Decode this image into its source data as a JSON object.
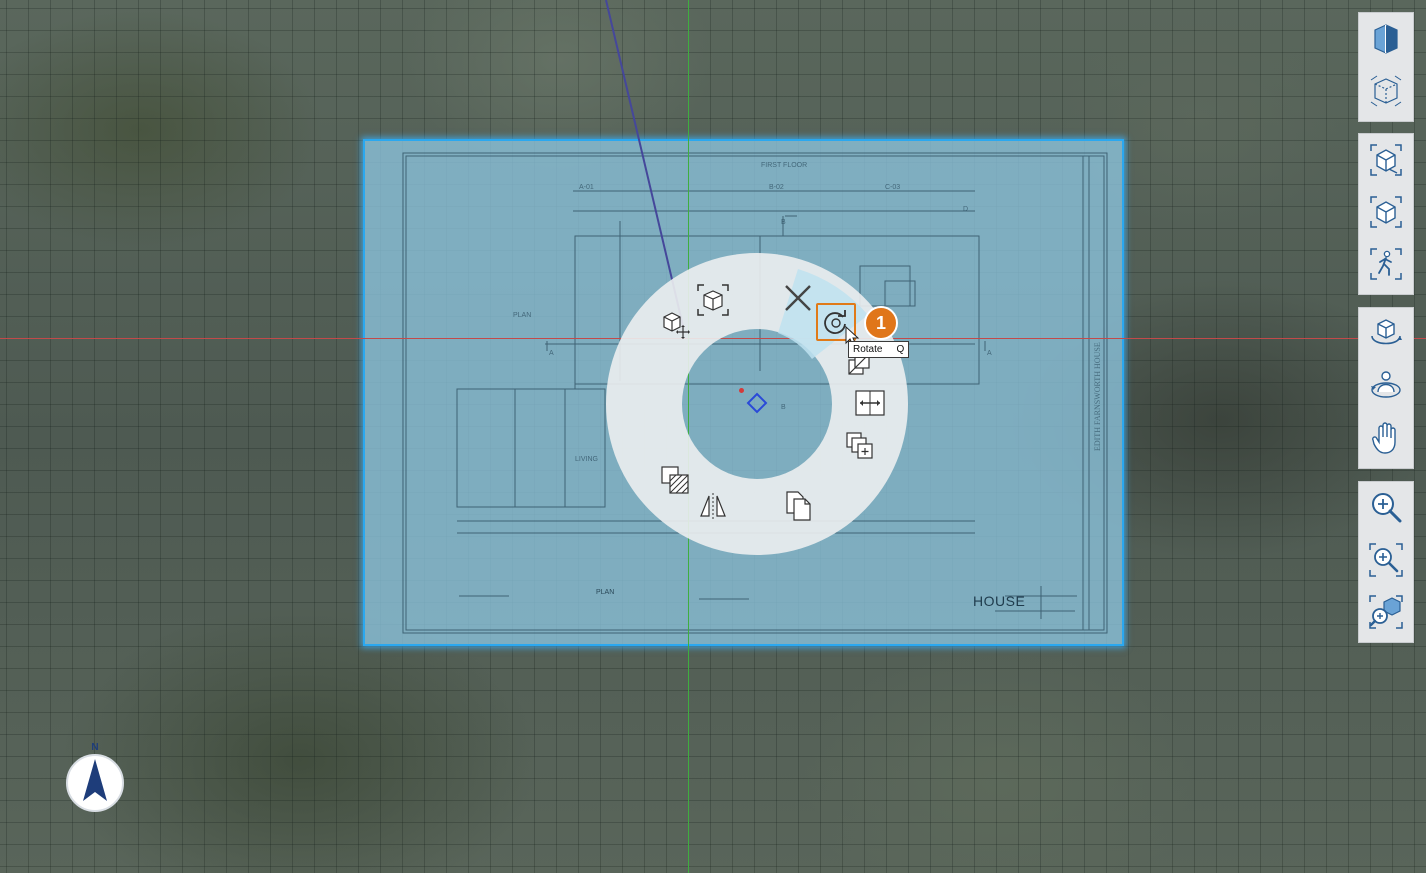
{
  "canvas": {
    "sheet": {
      "house_label": "HOUSE",
      "plan_label": "PLAN",
      "north_label": "N"
    },
    "radial_menu": {
      "items": [
        {
          "name": "move-icon",
          "label": "Move"
        },
        {
          "name": "frame-object-icon",
          "label": "Frame"
        },
        {
          "name": "delete-icon",
          "label": "Delete"
        },
        {
          "name": "rotate-icon",
          "label": "Rotate"
        },
        {
          "name": "scale-icon",
          "label": "Scale"
        },
        {
          "name": "stretch-icon",
          "label": "Stretch"
        },
        {
          "name": "duplicate-icon",
          "label": "Duplicate"
        },
        {
          "name": "copy-icon",
          "label": "Copy"
        },
        {
          "name": "mirror-icon",
          "label": "Mirror"
        },
        {
          "name": "material-icon",
          "label": "Material"
        }
      ],
      "active_item": "Rotate"
    },
    "tooltip": {
      "label": "Rotate",
      "shortcut": "Q"
    },
    "callout": "1",
    "compass_label": "N"
  },
  "toolbar": {
    "groups": [
      {
        "items": [
          "section-box-icon",
          "x-ray-icon"
        ]
      },
      {
        "items": [
          "orbit-view-icon",
          "home-view-icon",
          "walk-icon"
        ]
      },
      {
        "items": [
          "orbit-icon",
          "look-around-icon",
          "pan-hand-icon"
        ]
      },
      {
        "items": [
          "zoom-icon",
          "zoom-window-icon",
          "zoom-extents-icon"
        ]
      }
    ]
  },
  "colors": {
    "selection": "#2aa8f0",
    "callout": "#e0761a",
    "x_axis": "#c24a4a",
    "y_axis": "#3fae3f"
  }
}
